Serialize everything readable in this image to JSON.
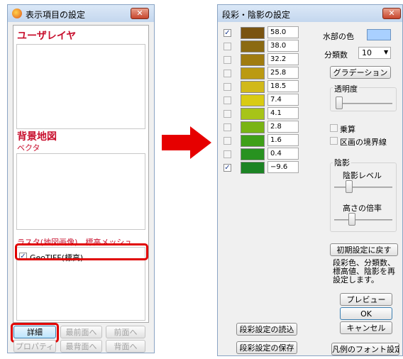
{
  "left_window": {
    "title": "表示項目の設定",
    "close": "✕",
    "user_layer_title": "ユーザレイヤ",
    "bg_map_title": "背景地図",
    "bg_map_sub": "ベクタ",
    "raster_label": "ラスタ(地図画像)、標高メッシュ",
    "geotiff_label": "GeoTIFF(標高)",
    "buttons": {
      "detail": "詳細",
      "front_most": "最前面へ",
      "front": "前面へ",
      "property": "プロパティ",
      "back_most": "最背面へ",
      "back": "背面へ"
    }
  },
  "right_window": {
    "title": "段彩・陰影の設定",
    "close": "✕",
    "rows": [
      {
        "checked": true,
        "color": "#7a5410",
        "value": "58.0"
      },
      {
        "checked": false,
        "color": "#8b6a12",
        "value": "38.0"
      },
      {
        "checked": false,
        "color": "#a07c10",
        "value": "32.2"
      },
      {
        "checked": false,
        "color": "#bb9a12",
        "value": "25.8"
      },
      {
        "checked": false,
        "color": "#d1b91a",
        "value": "18.5"
      },
      {
        "checked": false,
        "color": "#d9cb13",
        "value": "7.4"
      },
      {
        "checked": false,
        "color": "#a7c418",
        "value": "4.1"
      },
      {
        "checked": false,
        "color": "#79b414",
        "value": "2.8"
      },
      {
        "checked": false,
        "color": "#3fa018",
        "value": "1.6"
      },
      {
        "checked": false,
        "color": "#289220",
        "value": "0.4"
      },
      {
        "checked": true,
        "color": "#1c8424",
        "value": "−9.6"
      }
    ],
    "water_color_label": "水部の色",
    "water_color": "#a9d0ff",
    "classes_label": "分類数",
    "classes_value": "10",
    "gradation_button": "グラデーション",
    "transparency_label": "透明度",
    "multiply_label": "乗算",
    "boundary_label": "区画の境界線",
    "shading_label": "陰影",
    "shade_level_label": "陰影レベル",
    "height_ratio_label": "高さの倍率",
    "reset_button": "初期設定に戻す",
    "reset_note_line1": "段彩色、分類数、",
    "reset_note_line2": "標高値、陰影を再",
    "reset_note_line3": "設定します。",
    "preview_button": "プレビュー",
    "ok_button": "OK",
    "cancel_button": "キャンセル",
    "load_button": "段彩設定の読込",
    "save_button": "段彩設定の保存",
    "legend_font_button": "凡例のフォント設定"
  },
  "arrow_color": "#e60000",
  "highlight_color": "#e00000"
}
